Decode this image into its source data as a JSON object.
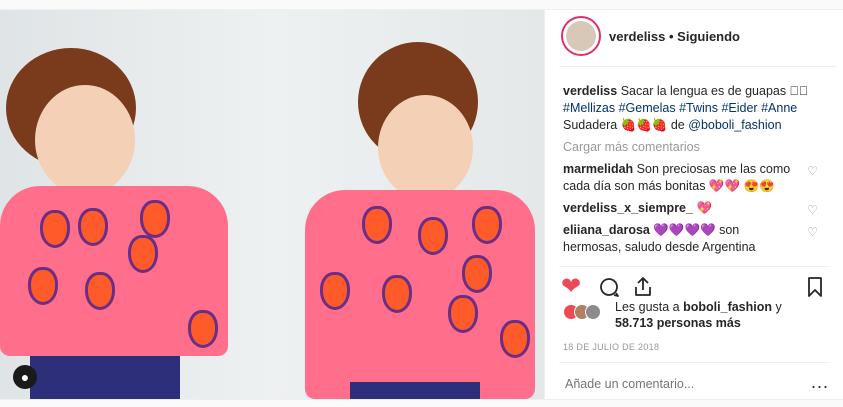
{
  "post": {
    "username": "verdeliss",
    "follow_status": "Siguiendo",
    "caption": {
      "user": "verdeliss",
      "text": "Sacar la lengua es de guapas ☐🏻",
      "tags": [
        "#Mellizas",
        "#Gemelas",
        "#Twins",
        "#Eider",
        "#Anne"
      ],
      "credit_prefix": "Sudadera 🍓🍓🍓 de",
      "credit_handle": "@boboli_fashion"
    },
    "load_more": "Cargar más comentarios",
    "comments": [
      {
        "user": "marmelidah",
        "text": "Son preciosas me las como cada día son más bonitas 💖💖 😍😍"
      },
      {
        "user": "verdeliss_x_siempre_",
        "text": "💖"
      },
      {
        "user": "eliiana_darosa",
        "text": "💜💜💜💜 son hermosas, saludo desde Argentina"
      }
    ],
    "likes": {
      "prefix": "Les gusta a",
      "user": "boboli_fashion",
      "suffix": "y",
      "count": "58.713 personas más"
    },
    "date": "18 DE JULIO DE 2018",
    "add_comment_placeholder": "Añade un comentario...",
    "more_label": "...",
    "colors": {
      "accent_red": "#ed4956",
      "link": "#003569",
      "muted": "#999999"
    },
    "icons": [
      "heart-filled-icon",
      "comment-icon",
      "share-icon",
      "bookmark-icon",
      "user-tag-icon"
    ]
  }
}
